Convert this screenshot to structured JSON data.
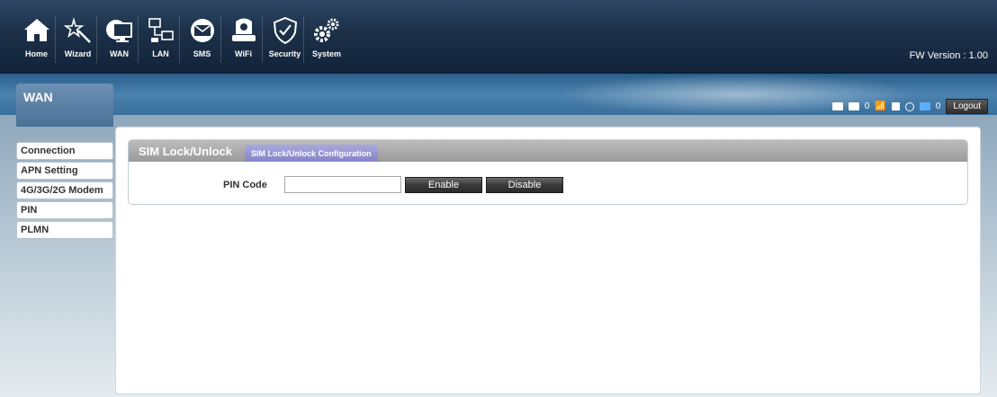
{
  "nav": {
    "items": [
      {
        "label": "Home",
        "icon": "home-icon"
      },
      {
        "label": "Wizard",
        "icon": "wand-icon"
      },
      {
        "label": "WAN",
        "icon": "monitor-globe-icon"
      },
      {
        "label": "LAN",
        "icon": "network-icon"
      },
      {
        "label": "SMS",
        "icon": "envelope-icon"
      },
      {
        "label": "WiFi",
        "icon": "wifi-router-icon"
      },
      {
        "label": "Security",
        "icon": "shield-icon"
      },
      {
        "label": "System",
        "icon": "gears-icon"
      }
    ]
  },
  "fw_version": "FW Version : 1.00",
  "section_title": "WAN",
  "status": {
    "sms_count": "0",
    "wifi_clients": "0",
    "logout_label": "Logout"
  },
  "sidebar": {
    "items": [
      {
        "label": "Connection"
      },
      {
        "label": "APN Setting"
      },
      {
        "label": "4G/3G/2G Modem"
      },
      {
        "label": "PIN"
      },
      {
        "label": "PLMN"
      }
    ]
  },
  "panel": {
    "title": "SIM Lock/Unlock",
    "tab": "SIM Lock/Unlock Configuration",
    "pin_label": "PIN Code",
    "pin_value": "",
    "pin_placeholder": "",
    "enable_label": "Enable",
    "disable_label": "Disable"
  },
  "colors": {
    "topbar": "#1c3048",
    "band": "#4c82ae",
    "tab": "#8484c7",
    "button": "#3a3a3a"
  }
}
